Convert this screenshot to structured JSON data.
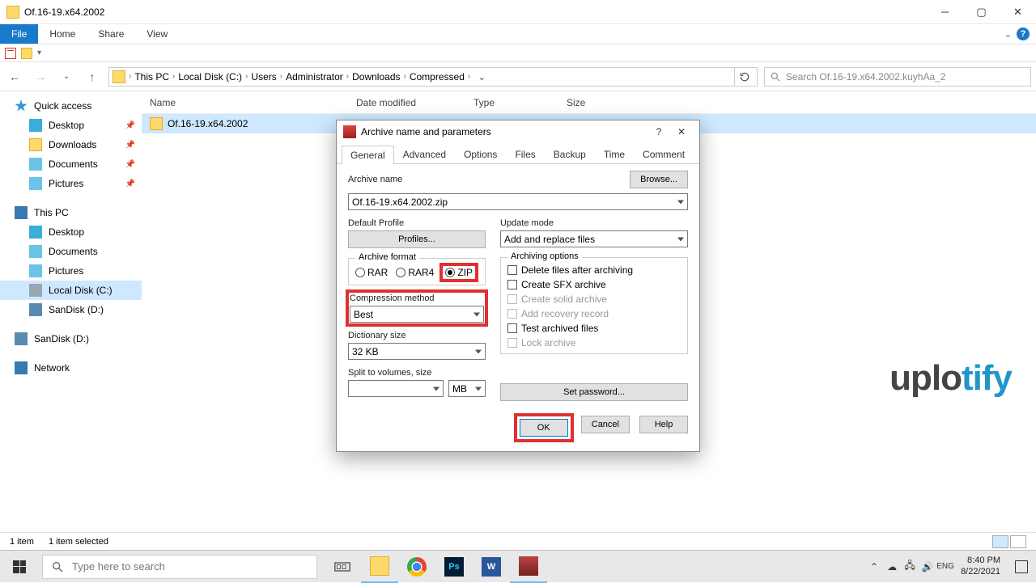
{
  "window": {
    "title": "Of.16-19.x64.2002",
    "tabs": {
      "file": "File",
      "home": "Home",
      "share": "Share",
      "view": "View"
    }
  },
  "breadcrumb": [
    "This PC",
    "Local Disk (C:)",
    "Users",
    "Administrator",
    "Downloads",
    "Compressed"
  ],
  "search_placeholder": "Search Of.16-19.x64.2002.kuyhAa_2",
  "columns": {
    "name": "Name",
    "date": "Date modified",
    "type": "Type",
    "size": "Size"
  },
  "rows": [
    {
      "name": "Of.16-19.x64.2002"
    }
  ],
  "sidebar": {
    "quick": "Quick access",
    "q_items": [
      "Desktop",
      "Downloads",
      "Documents",
      "Pictures"
    ],
    "thispc": "This PC",
    "pc_items": [
      "Desktop",
      "Documents",
      "Pictures",
      "Local Disk (C:)",
      "SanDisk (D:)"
    ],
    "sandisk": "SanDisk (D:)",
    "network": "Network"
  },
  "statusbar": {
    "count": "1 item",
    "selected": "1 item selected"
  },
  "watermark": {
    "a": "uplo",
    "b": "tify"
  },
  "dialog": {
    "title": "Archive name and parameters",
    "tabs": [
      "General",
      "Advanced",
      "Options",
      "Files",
      "Backup",
      "Time",
      "Comment"
    ],
    "archive_name_label": "Archive name",
    "browse": "Browse...",
    "archive_name": "Of.16-19.x64.2002.zip",
    "default_profile": "Default Profile",
    "profiles": "Profiles...",
    "update_mode_label": "Update mode",
    "update_mode": "Add and replace files",
    "archive_format_label": "Archive format",
    "formats": {
      "rar": "RAR",
      "rar4": "RAR4",
      "zip": "ZIP"
    },
    "compression_label": "Compression method",
    "compression": "Best",
    "dict_label": "Dictionary size",
    "dict": "32 KB",
    "split_label": "Split to volumes, size",
    "split_unit": "MB",
    "archiving_options_label": "Archiving options",
    "opts": {
      "delete": "Delete files after archiving",
      "sfx": "Create SFX archive",
      "solid": "Create solid archive",
      "recovery": "Add recovery record",
      "test": "Test archived files",
      "lock": "Lock archive"
    },
    "set_password": "Set password...",
    "ok": "OK",
    "cancel": "Cancel",
    "help": "Help"
  },
  "taskbar": {
    "search": "Type here to search",
    "time": "8:40 PM",
    "date": "8/22/2021"
  }
}
